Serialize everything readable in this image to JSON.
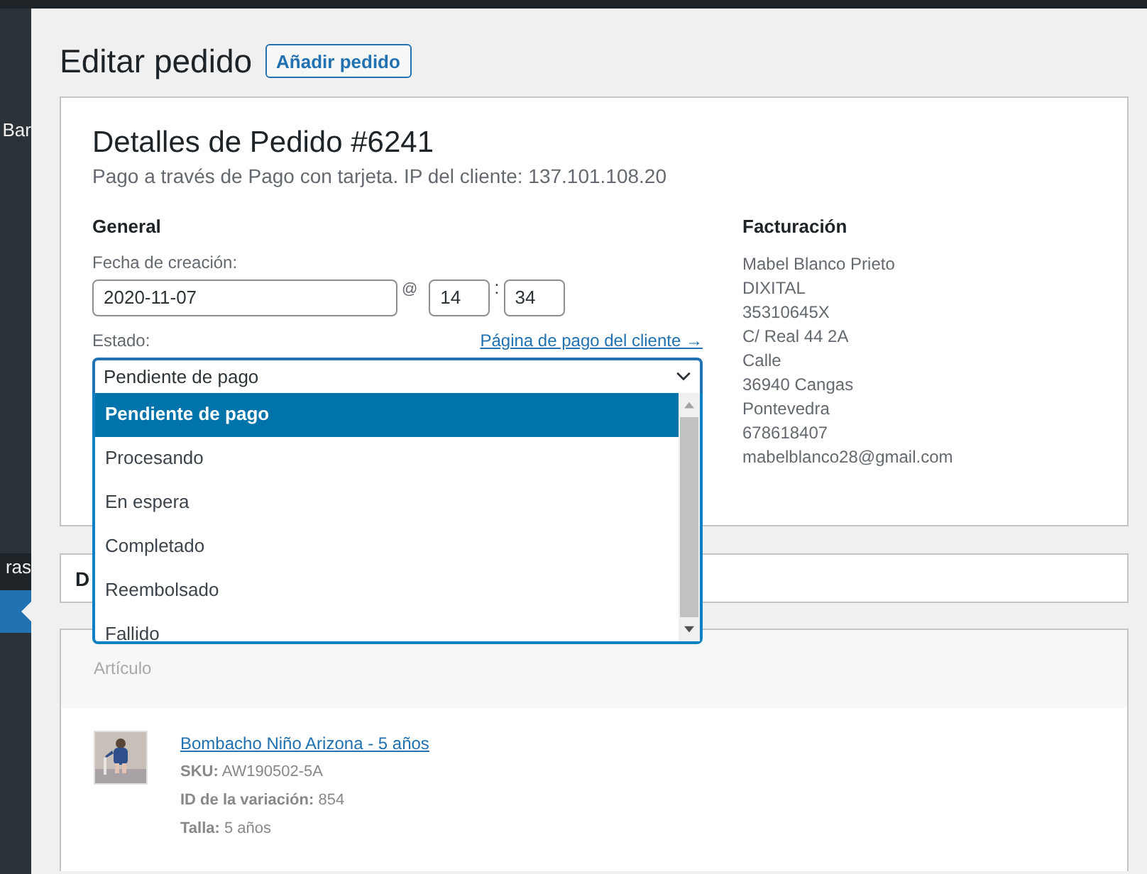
{
  "sidebar": {
    "items": [
      {
        "label": "Bar",
        "selected": false
      },
      {
        "label": "ras",
        "selected": false
      },
      {
        "selected": true
      }
    ]
  },
  "page": {
    "title": "Editar pedido",
    "add_button": "Añadir pedido"
  },
  "order": {
    "title": "Detalles de Pedido #6241",
    "subtitle": "Pago a través de Pago con tarjeta. IP del cliente: 137.101.108.20",
    "general": {
      "heading": "General",
      "date_label": "Fecha de creación:",
      "date": "2020-11-07",
      "at": "@",
      "hour": "14",
      "colon": ":",
      "minute": "34",
      "status_label": "Estado:",
      "payment_link": "Página de pago del cliente →",
      "status": {
        "value": "Pendiente de pago",
        "expanded": true,
        "options": [
          {
            "label": "Pendiente de pago",
            "selected": true
          },
          {
            "label": "Procesando",
            "selected": false
          },
          {
            "label": "En espera",
            "selected": false
          },
          {
            "label": "Completado",
            "selected": false
          },
          {
            "label": "Reembolsado",
            "selected": false
          },
          {
            "label": "Fallido",
            "selected": false
          }
        ]
      }
    },
    "billing": {
      "heading": "Facturación",
      "lines": [
        "Mabel Blanco Prieto",
        "DIXITAL",
        "35310645X",
        "C/ Real 44 2A",
        "Calle",
        "36940 Cangas",
        "Pontevedra",
        "678618407",
        "mabelblanco28@gmail.com"
      ]
    }
  },
  "second_box": {
    "title": "D"
  },
  "items": {
    "column_header": "Artículo",
    "rows": [
      {
        "name": "Bombacho Niño Arizona - 5 años",
        "meta": [
          "**SKU:** AW190502-5A",
          "**ID de la variación:** 854",
          "**Talla:** 5 años"
        ]
      }
    ]
  }
}
